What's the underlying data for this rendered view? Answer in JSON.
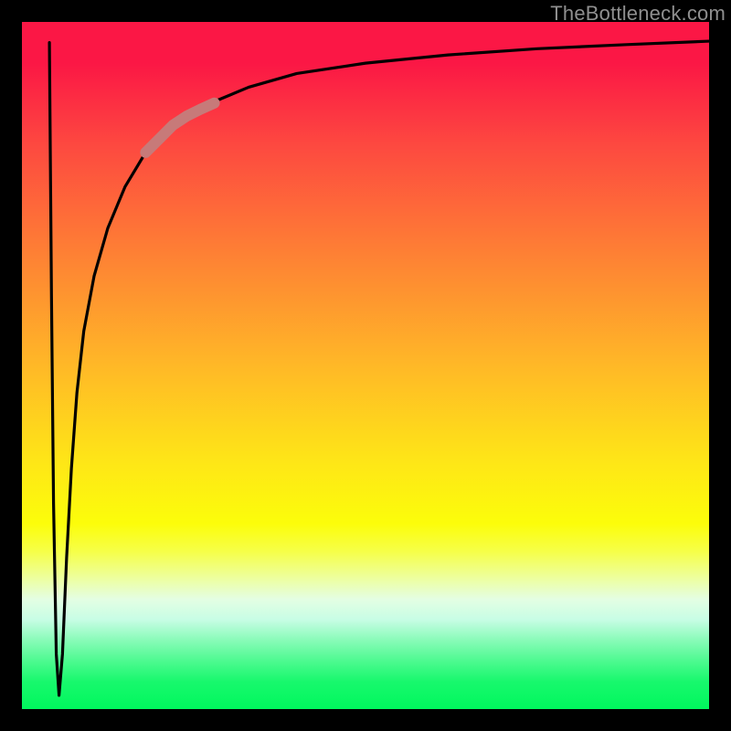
{
  "watermark": "TheBottleneck.com",
  "chart_data": {
    "type": "line",
    "title": "",
    "xlabel": "",
    "ylabel": "",
    "xlim": [
      0,
      100
    ],
    "ylim": [
      0,
      100
    ],
    "grid": false,
    "legend": false,
    "series": [
      {
        "name": "bottleneck-curve",
        "color": "#000000",
        "x": [
          4.0,
          4.3,
          4.6,
          5.0,
          5.4,
          5.9,
          6.5,
          7.2,
          8.0,
          9.0,
          10.5,
          12.5,
          15.0,
          18.0,
          22.0,
          27.0,
          33.0,
          40.0,
          50.0,
          62.0,
          75.0,
          88.0,
          100.0
        ],
        "values": [
          97,
          60,
          30,
          8,
          2,
          8,
          22,
          35,
          46,
          55,
          63,
          70,
          76,
          81,
          85,
          88,
          90.5,
          92.5,
          94,
          95.2,
          96.1,
          96.7,
          97.2
        ]
      },
      {
        "name": "highlight-segment",
        "color": "#c77a79",
        "x": [
          18.0,
          20.0,
          22.0,
          24.0,
          26.0,
          28.0
        ],
        "values": [
          81,
          83,
          85,
          86.3,
          87.3,
          88.2
        ]
      }
    ]
  },
  "colors": {
    "frame": "#000000",
    "curve": "#000000",
    "highlight": "#c77a79"
  }
}
